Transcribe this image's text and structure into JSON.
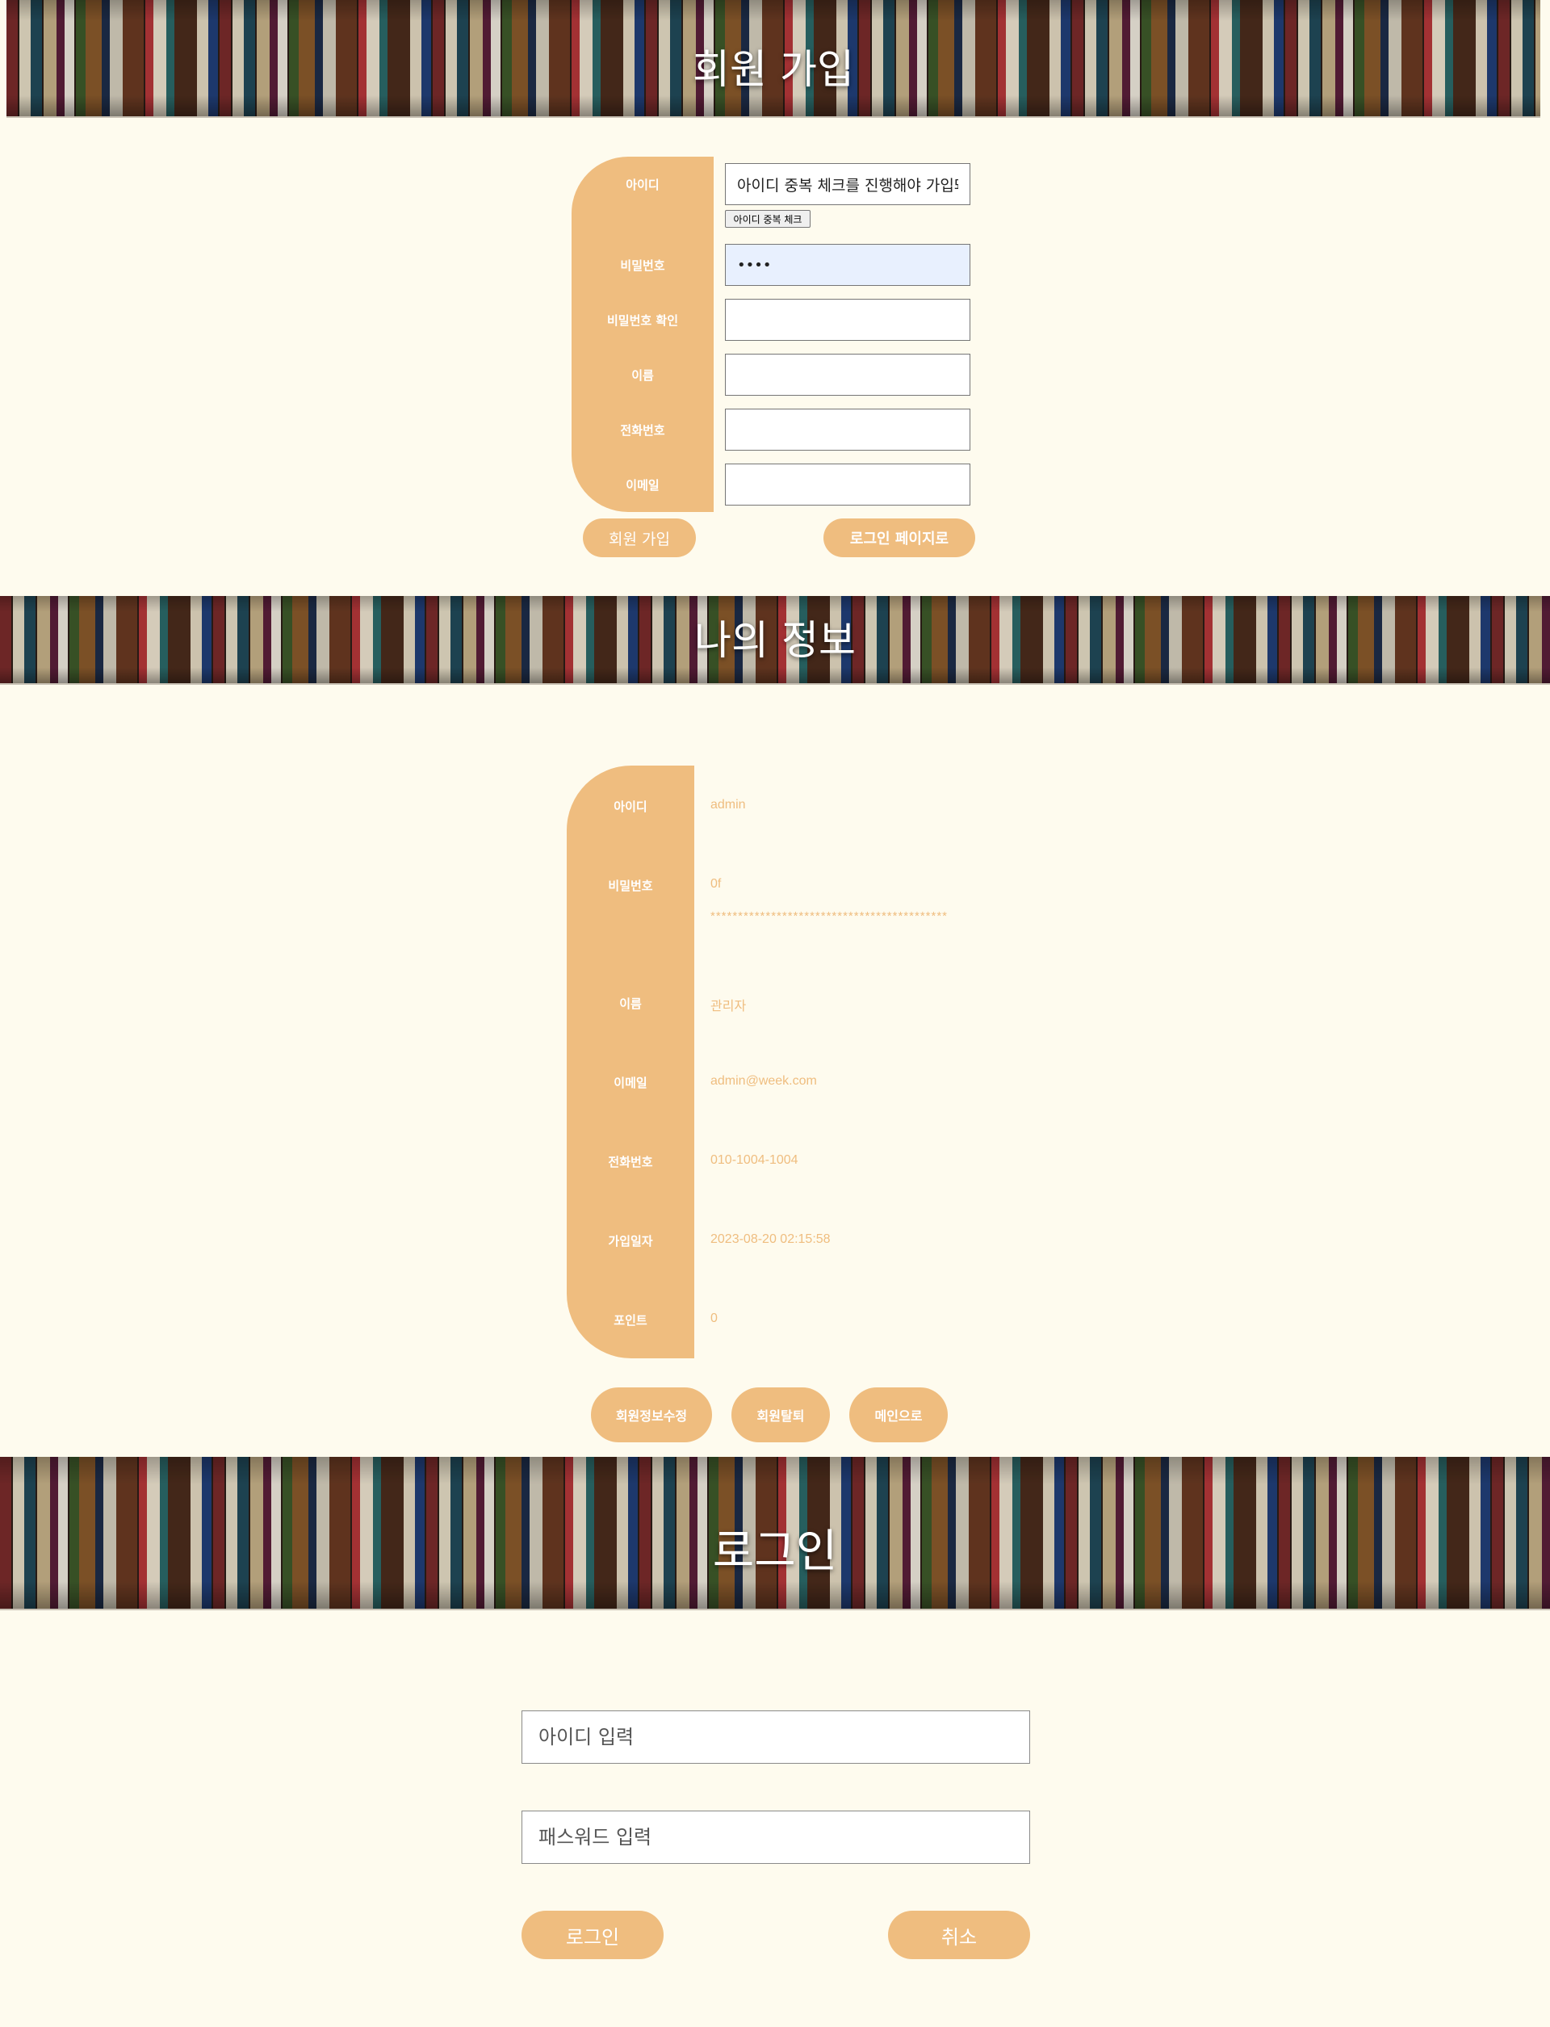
{
  "signup": {
    "title": "회원 가입",
    "labels": {
      "id": "아이디",
      "password": "비밀번호",
      "password_confirm": "비밀번호 확인",
      "name": "이름",
      "phone": "전화번호",
      "email": "이메일"
    },
    "id_value": "아이디 중복 체크를 진행해야 가입돼",
    "dup_check_label": "아이디 중복 체크",
    "password_value": "••••",
    "submit_label": "회원 가입",
    "to_login_label": "로그인 페이지로"
  },
  "myinfo": {
    "title": "나의 정보",
    "labels": {
      "id": "아이디",
      "password": "비밀번호",
      "name": "이름",
      "email": "이메일",
      "phone": "전화번호",
      "joined": "가입일자",
      "points": "포인트"
    },
    "values": {
      "id": "admin",
      "password": "0f",
      "password_stars": "*******************************************",
      "name": "관리자",
      "email": "admin@week.com",
      "phone": "010-1004-1004",
      "joined": "2023-08-20 02:15:58",
      "points": "0"
    },
    "buttons": {
      "edit": "회원정보수정",
      "withdraw": "회원탈퇴",
      "main": "메인으로"
    }
  },
  "login": {
    "title": "로그인",
    "id_placeholder": "아이디 입력",
    "password_placeholder": "패스워드 입력",
    "login_label": "로그인",
    "cancel_label": "취소"
  },
  "colors": {
    "accent": "#efbd7f",
    "background": "#fefbee",
    "autofill": "#e8f0fe"
  }
}
